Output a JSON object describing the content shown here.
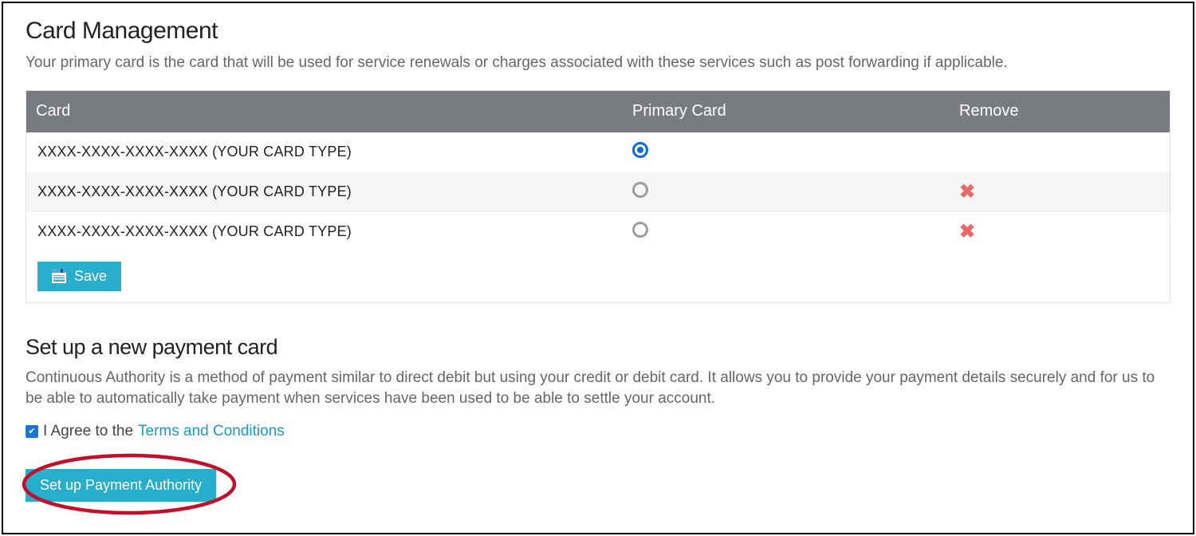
{
  "cardManagement": {
    "title": "Card Management",
    "subtitle": "Your primary card is the card that will be used for service renewals or charges associated with these services such as post forwarding if applicable.",
    "headers": {
      "card": "Card",
      "primary": "Primary Card",
      "remove": "Remove"
    },
    "rows": [
      {
        "label": "XXXX-XXXX-XXXX-XXXX (YOUR CARD TYPE)",
        "primary": true,
        "removable": false
      },
      {
        "label": "XXXX-XXXX-XXXX-XXXX (YOUR CARD TYPE)",
        "primary": false,
        "removable": true
      },
      {
        "label": "XXXX-XXXX-XXXX-XXXX (YOUR CARD TYPE)",
        "primary": false,
        "removable": true
      }
    ],
    "saveLabel": "Save"
  },
  "newCard": {
    "title": "Set up a new payment card",
    "desc": "Continuous Authority is a method of payment similar to direct debit but using your credit or debit card. It allows you to provide your payment details securely and for us to be able to automatically take payment when services have been used to be able to settle your account.",
    "agreePrefix": "I Agree to the ",
    "termsLabel": "Terms and Conditions",
    "agreed": true,
    "setupLabel": "Set up Payment Authority"
  },
  "colors": {
    "accent": "#27aecc",
    "headerBg": "#787c81",
    "radioSelected": "#0b6dd6",
    "removeX": "#eb6969",
    "annotation": "#c20f2a"
  }
}
